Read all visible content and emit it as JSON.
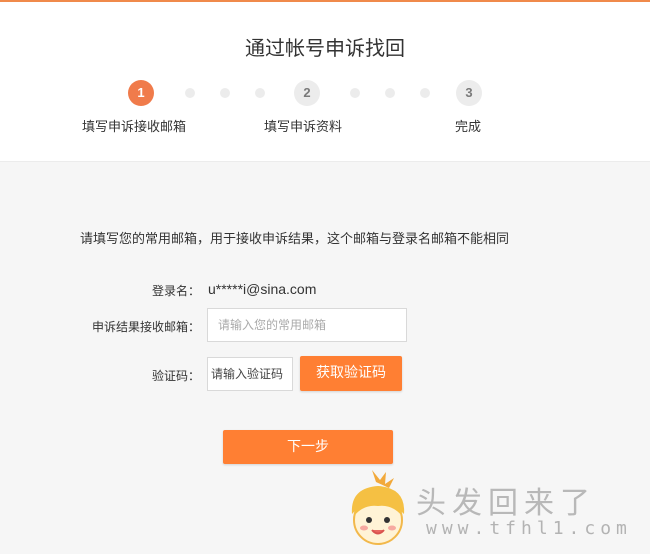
{
  "page": {
    "title": "通过帐号申诉找回"
  },
  "steps": [
    {
      "number": "1",
      "label": "填写申诉接收邮箱",
      "active": true
    },
    {
      "number": "2",
      "label": "填写申诉资料",
      "active": false
    },
    {
      "number": "3",
      "label": "完成",
      "active": false
    }
  ],
  "form": {
    "instruction": "请填写您的常用邮箱，用于接收申诉结果，这个邮箱与登录名邮箱不能相同",
    "login_label": "登录名：",
    "login_value": "u*****i@sina.com",
    "email_label": "申诉结果接收邮箱：",
    "email_placeholder": "请输入您的常用邮箱",
    "email_value": "",
    "captcha_label": "验证码：",
    "captcha_placeholder": "请输入验证码",
    "captcha_value": "",
    "get_code_button": "获取验证码",
    "next_button": "下一步"
  },
  "watermark": {
    "title": "头发回来了",
    "url": "www.tfhl1.com"
  },
  "colors": {
    "accent": "#ff7f33",
    "active_step": "#f07b4b",
    "inactive_step": "#ececec"
  },
  "icons": {
    "mascot": "cartoon-girl-face-icon"
  }
}
